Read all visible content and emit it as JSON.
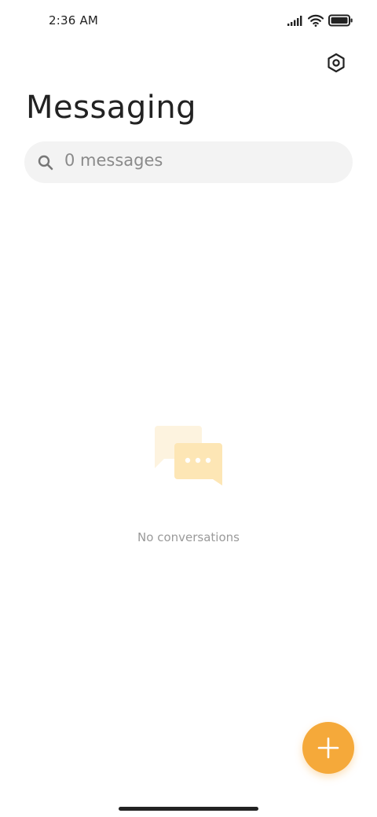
{
  "status_bar": {
    "time": "2:36 AM",
    "icons": [
      "signal-icon",
      "wifi-icon",
      "battery-icon"
    ]
  },
  "header": {
    "title": "Messaging",
    "settings_icon": "settings-hexagon-icon"
  },
  "search": {
    "placeholder": "0 messages",
    "icon": "search-icon"
  },
  "empty_state": {
    "icon": "chat-bubbles-icon",
    "text": "No conversations"
  },
  "fab": {
    "icon": "plus-icon"
  },
  "colors": {
    "accent": "#f5a93a",
    "illustration_back": "#fdf3df",
    "illustration_front": "#fde6b5",
    "search_bg": "#f3f3f3",
    "text_primary": "#222222",
    "text_secondary": "#9a9a9a"
  }
}
